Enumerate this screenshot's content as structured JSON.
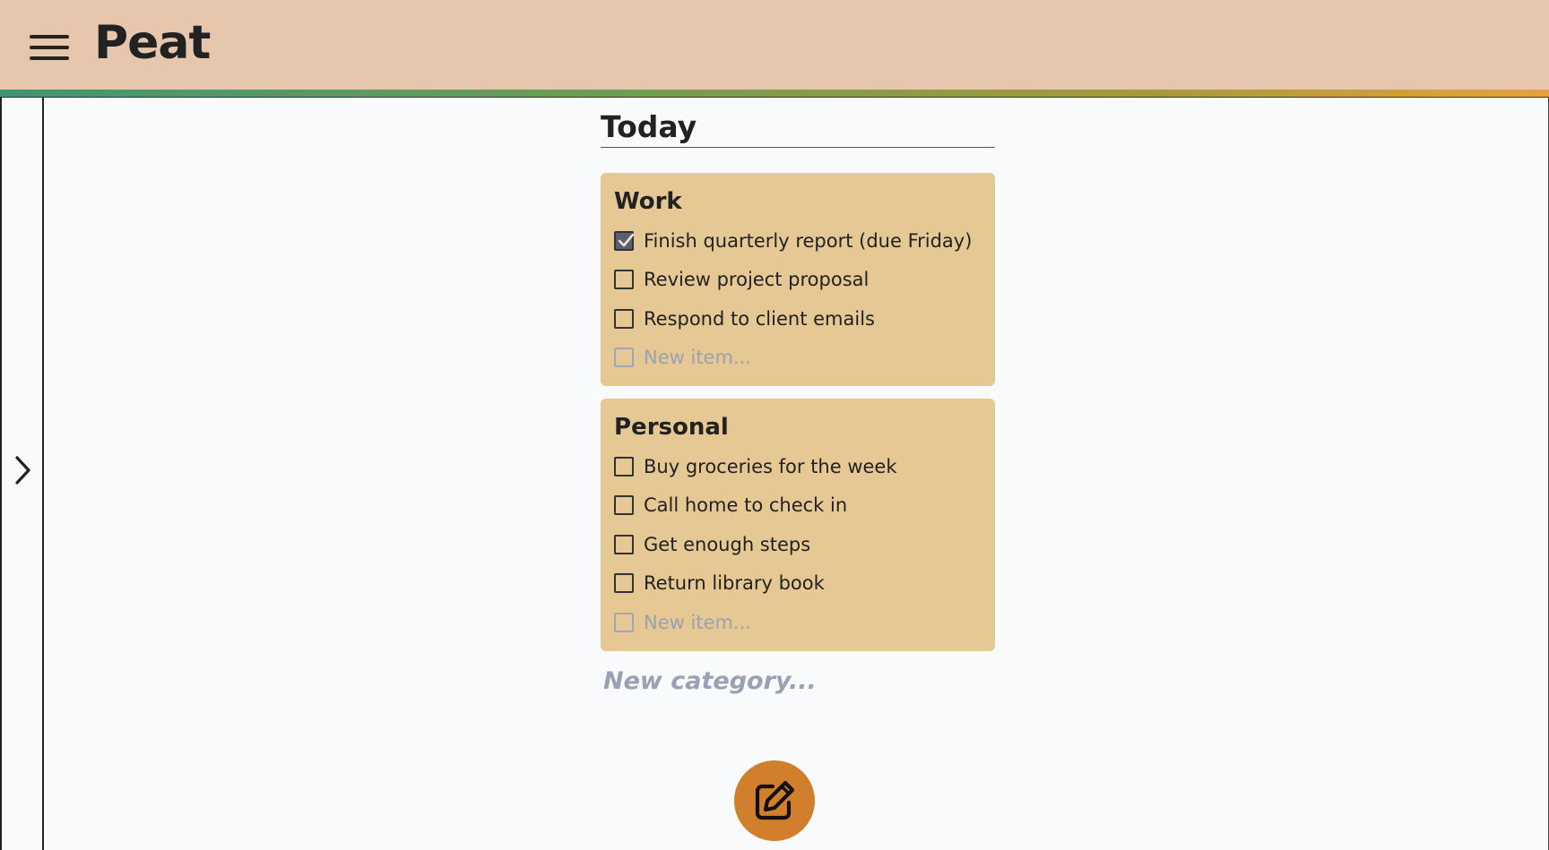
{
  "app": {
    "title": "Peat"
  },
  "header": {
    "menu_icon": "hamburger-menu-icon",
    "brand_label": "Peat"
  },
  "sidebar": {
    "toggle_icon": "chevron-right-icon"
  },
  "main": {
    "page_title": "Today",
    "categories": [
      {
        "name": "Work",
        "items": [
          {
            "label": "Finish quarterly report (due Friday)",
            "checked": true
          },
          {
            "label": "Review project proposal",
            "checked": false
          },
          {
            "label": "Respond to client emails",
            "checked": false
          }
        ],
        "new_item_placeholder": "New item..."
      },
      {
        "name": "Personal",
        "items": [
          {
            "label": "Buy groceries for the week",
            "checked": false
          },
          {
            "label": "Call home to check in",
            "checked": false
          },
          {
            "label": "Get enough steps",
            "checked": false
          },
          {
            "label": "Return library book",
            "checked": false
          }
        ],
        "new_item_placeholder": "New item..."
      }
    ],
    "new_category_placeholder": "New category..."
  },
  "fab": {
    "icon": "edit-icon"
  },
  "colors": {
    "header_bg": "#e7c6ae",
    "card_bg": "#e5c893",
    "fab_bg": "#d17f2c",
    "stripe_start": "#3e9673",
    "stripe_end": "#e8a23a"
  }
}
